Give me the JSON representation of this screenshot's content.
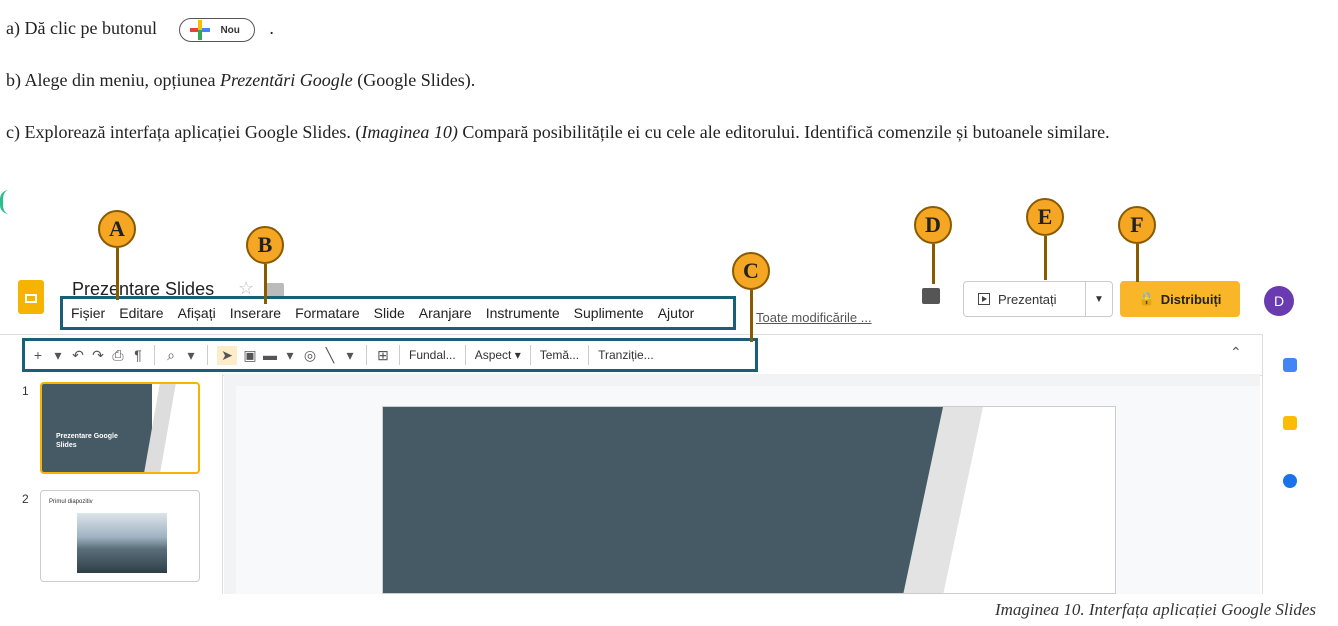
{
  "instructions": {
    "a_prefix": "a) Dă clic pe butonul",
    "a_suffix": ".",
    "nou_button": "Nou",
    "b_prefix": "b) Alege din meniu, opțiunea ",
    "b_italic": "Prezentări Google",
    "b_suffix": " (Google Slides).",
    "c_prefix": "c) Explorează interfața aplicației Google Slides. (",
    "c_italic": "Imaginea 10)",
    "c_suffix": " Compară posibilitățile ei cu cele ale editorului. Identifică comenzile și butoanele similare."
  },
  "slides_ui": {
    "doc_title": "Prezentare Slides",
    "menu": [
      "Fișier",
      "Editare",
      "Afișați",
      "Inserare",
      "Formatare",
      "Slide",
      "Aranjare",
      "Instrumente",
      "Suplimente",
      "Ajutor"
    ],
    "last_edit": "Toate modificările ...",
    "toolbar_buttons": [
      "Fundal...",
      "Aspect ▾",
      "Temă...",
      "Tranziție..."
    ],
    "present_label": "Prezentați",
    "share_label": "Distribuiți",
    "avatar_letter": "D",
    "thumb1_number": "1",
    "thumb1_title": "Prezentare Google Slides",
    "thumb2_number": "2",
    "thumb2_title": "Primul diapozitiv"
  },
  "callouts": [
    "A",
    "B",
    "C",
    "D",
    "E",
    "F"
  ],
  "caption": "Imaginea 10. Interfața aplicației Google Slides",
  "colors": {
    "callout": "#f5a623",
    "frame": "#1b5e78",
    "share": "#f8b628",
    "avatar": "#6a3bb0",
    "slide_dark": "#455a64"
  }
}
